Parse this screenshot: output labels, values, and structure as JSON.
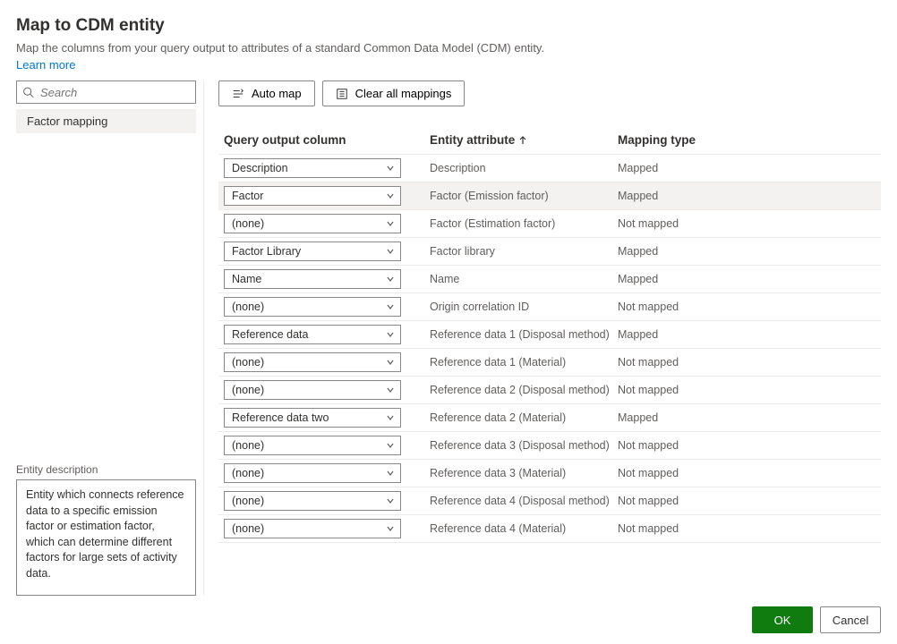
{
  "header": {
    "title": "Map to CDM entity",
    "subtitle": "Map the columns from your query output to attributes of a standard Common Data Model (CDM) entity.",
    "learn_more": "Learn more"
  },
  "sidebar": {
    "search_placeholder": "Search",
    "items": [
      {
        "label": "Factor mapping"
      }
    ],
    "entity_desc_label": "Entity description",
    "entity_desc_text": "Entity which connects reference data to a specific emission factor or estimation factor, which can determine different factors for large sets of activity data."
  },
  "toolbar": {
    "auto_map": "Auto map",
    "clear_all": "Clear all mappings"
  },
  "table": {
    "headers": {
      "query": "Query output column",
      "attr": "Entity attribute",
      "type": "Mapping type"
    },
    "rows": [
      {
        "query": "Description",
        "attr": "Description",
        "type": "Mapped",
        "active": false
      },
      {
        "query": "Factor",
        "attr": "Factor (Emission factor)",
        "type": "Mapped",
        "active": true
      },
      {
        "query": "(none)",
        "attr": "Factor (Estimation factor)",
        "type": "Not mapped",
        "active": false
      },
      {
        "query": "Factor Library",
        "attr": "Factor library",
        "type": "Mapped",
        "active": false
      },
      {
        "query": "Name",
        "attr": "Name",
        "type": "Mapped",
        "active": false
      },
      {
        "query": "(none)",
        "attr": "Origin correlation ID",
        "type": "Not mapped",
        "active": false
      },
      {
        "query": "Reference data",
        "attr": "Reference data 1 (Disposal method)",
        "type": "Mapped",
        "active": false
      },
      {
        "query": "(none)",
        "attr": "Reference data 1 (Material)",
        "type": "Not mapped",
        "active": false
      },
      {
        "query": "(none)",
        "attr": "Reference data 2 (Disposal method)",
        "type": "Not mapped",
        "active": false
      },
      {
        "query": "Reference data two",
        "attr": "Reference data 2 (Material)",
        "type": "Mapped",
        "active": false
      },
      {
        "query": "(none)",
        "attr": "Reference data 3 (Disposal method)",
        "type": "Not mapped",
        "active": false
      },
      {
        "query": "(none)",
        "attr": "Reference data 3 (Material)",
        "type": "Not mapped",
        "active": false
      },
      {
        "query": "(none)",
        "attr": "Reference data 4 (Disposal method)",
        "type": "Not mapped",
        "active": false
      },
      {
        "query": "(none)",
        "attr": "Reference data 4 (Material)",
        "type": "Not mapped",
        "active": false
      }
    ]
  },
  "footer": {
    "ok": "OK",
    "cancel": "Cancel"
  }
}
